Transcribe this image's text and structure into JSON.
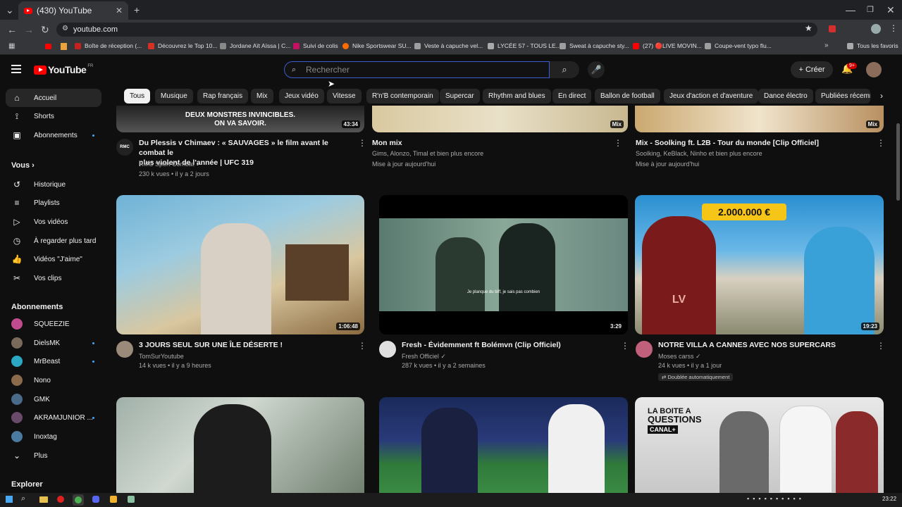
{
  "browser": {
    "tab_count_title": "(430) YouTube",
    "url": "youtube.com",
    "new_tab": "+"
  },
  "bookmarks": [
    {
      "label": "Boîte de réception (...",
      "color": "#c5221f"
    },
    {
      "label": "Découvrez le Top 10...",
      "color": "#d93025"
    },
    {
      "label": "Jordane Aït Aïssa | C...",
      "color": "#888888"
    },
    {
      "label": "Suivi de colis",
      "color": "#c51162"
    },
    {
      "label": "Nike Sportswear SU...",
      "color": "#ff6d00"
    },
    {
      "label": "Veste à capuche vel...",
      "color": "#9e9e9e"
    },
    {
      "label": "LYCÉE 57 - TOUS LE...",
      "color": "#aaaaaa"
    },
    {
      "label": "Sweat à capuche sty...",
      "color": "#9e9e9e"
    },
    {
      "label": "(27) 🔴LIVE MOVIN...",
      "color": "#ff0000"
    },
    {
      "label": "Coupe-vent typo flu...",
      "color": "#9e9e9e"
    }
  ],
  "bookmarks_all": "Tous les favoris",
  "header": {
    "logo": "YouTube",
    "logo_region": "FR",
    "search_placeholder": "Rechercher",
    "create_label": "Créer",
    "notif_badge": "9+"
  },
  "chips": [
    "Tous",
    "Musique",
    "Rap français",
    "Mix",
    "Jeux vidéo",
    "Vitesse",
    "R'n'B contemporain",
    "Supercar",
    "Rhythm and blues",
    "En direct",
    "Ballon de football",
    "Jeux d'action et d'aventure",
    "Dance électro",
    "Publiées récemme"
  ],
  "sidebar": {
    "main": [
      {
        "label": "Accueil",
        "icon": "home-icon"
      },
      {
        "label": "Shorts",
        "icon": "shorts-icon"
      },
      {
        "label": "Abonnements",
        "icon": "subscriptions-icon"
      }
    ],
    "you_heading": "Vous",
    "you": [
      {
        "label": "Historique",
        "icon": "history-icon"
      },
      {
        "label": "Playlists",
        "icon": "playlist-icon"
      },
      {
        "label": "Vos vidéos",
        "icon": "video-icon"
      },
      {
        "label": "À regarder plus tard",
        "icon": "clock-icon"
      },
      {
        "label": "Vidéos \"J'aime\"",
        "icon": "like-icon"
      },
      {
        "label": "Vos clips",
        "icon": "scissors-icon"
      }
    ],
    "subs_heading": "Abonnements",
    "subs": [
      {
        "label": "SQUEEZIE",
        "color": "#c04c8f"
      },
      {
        "label": "DielsMK",
        "color": "#7a6a5a"
      },
      {
        "label": "MrBeast",
        "color": "#2aa8c4"
      },
      {
        "label": "Nono",
        "color": "#8a6a4a"
      },
      {
        "label": "GMK",
        "color": "#4a6a8a"
      },
      {
        "label": "AKRAMJUNIOR ...",
        "color": "#6a4a6a"
      },
      {
        "label": "Inoxtag",
        "color": "#4a7aa0"
      }
    ],
    "more": "Plus",
    "explore": "Explorer"
  },
  "videos_top": [
    {
      "title1": "Du Plessis v Chimaev : « SAUVAGES » le film avant le combat le",
      "title2": "plus violent de l'année | UFC 319",
      "channel": "RMC Sport Combat",
      "meta": "230 k vues • il y a 2 jours",
      "duration": "43:34",
      "banner": "DEUX MONSTRES INVINCIBLES.",
      "banner2": "ON VA SAVOIR."
    },
    {
      "title1": "Mon mix",
      "title2": "",
      "channel": "Gims, Alonzo, Timal et bien plus encore",
      "meta": "Mise à jour aujourd'hui",
      "duration": "Mix"
    },
    {
      "title1": "Mix - Soolking ft. L2B - Tour du monde [Clip Officiel]",
      "title2": "",
      "channel": "Soolking, KeBlack, Ninho et bien plus encore",
      "meta": "Mise à jour aujourd'hui",
      "duration": "Mix"
    }
  ],
  "videos_mid": [
    {
      "title": "3 JOURS SEUL SUR UNE ÎLE DÉSERTE !",
      "channel": "TomSurYoutube",
      "meta": "14 k vues • il y a 9 heures",
      "duration": "1:06:48"
    },
    {
      "title": "Fresh - Évidemment ft Bolémvn (Clip Officiel)",
      "channel": "Fresh Officiel",
      "meta": "287 k vues • il y a 2 semaines",
      "duration": "3:29",
      "subtitle": "Je planque du biff, je sais pas combien"
    },
    {
      "title": "NOTRE VILLA A CANNES AVEC NOS SUPERCARS",
      "channel": "Moses carss",
      "meta": "24 k vues • il y a 1 jour",
      "duration": "19:23",
      "badge": "Doublée automatiquement",
      "price": "2.000.000 €",
      "jersey": "LV"
    }
  ],
  "videos_bottom": [
    {
      "text": "LA BOITE A",
      "text2": "QUESTIONS",
      "brand": "CANAL+"
    }
  ],
  "taskbar": {
    "time": "23:22"
  }
}
